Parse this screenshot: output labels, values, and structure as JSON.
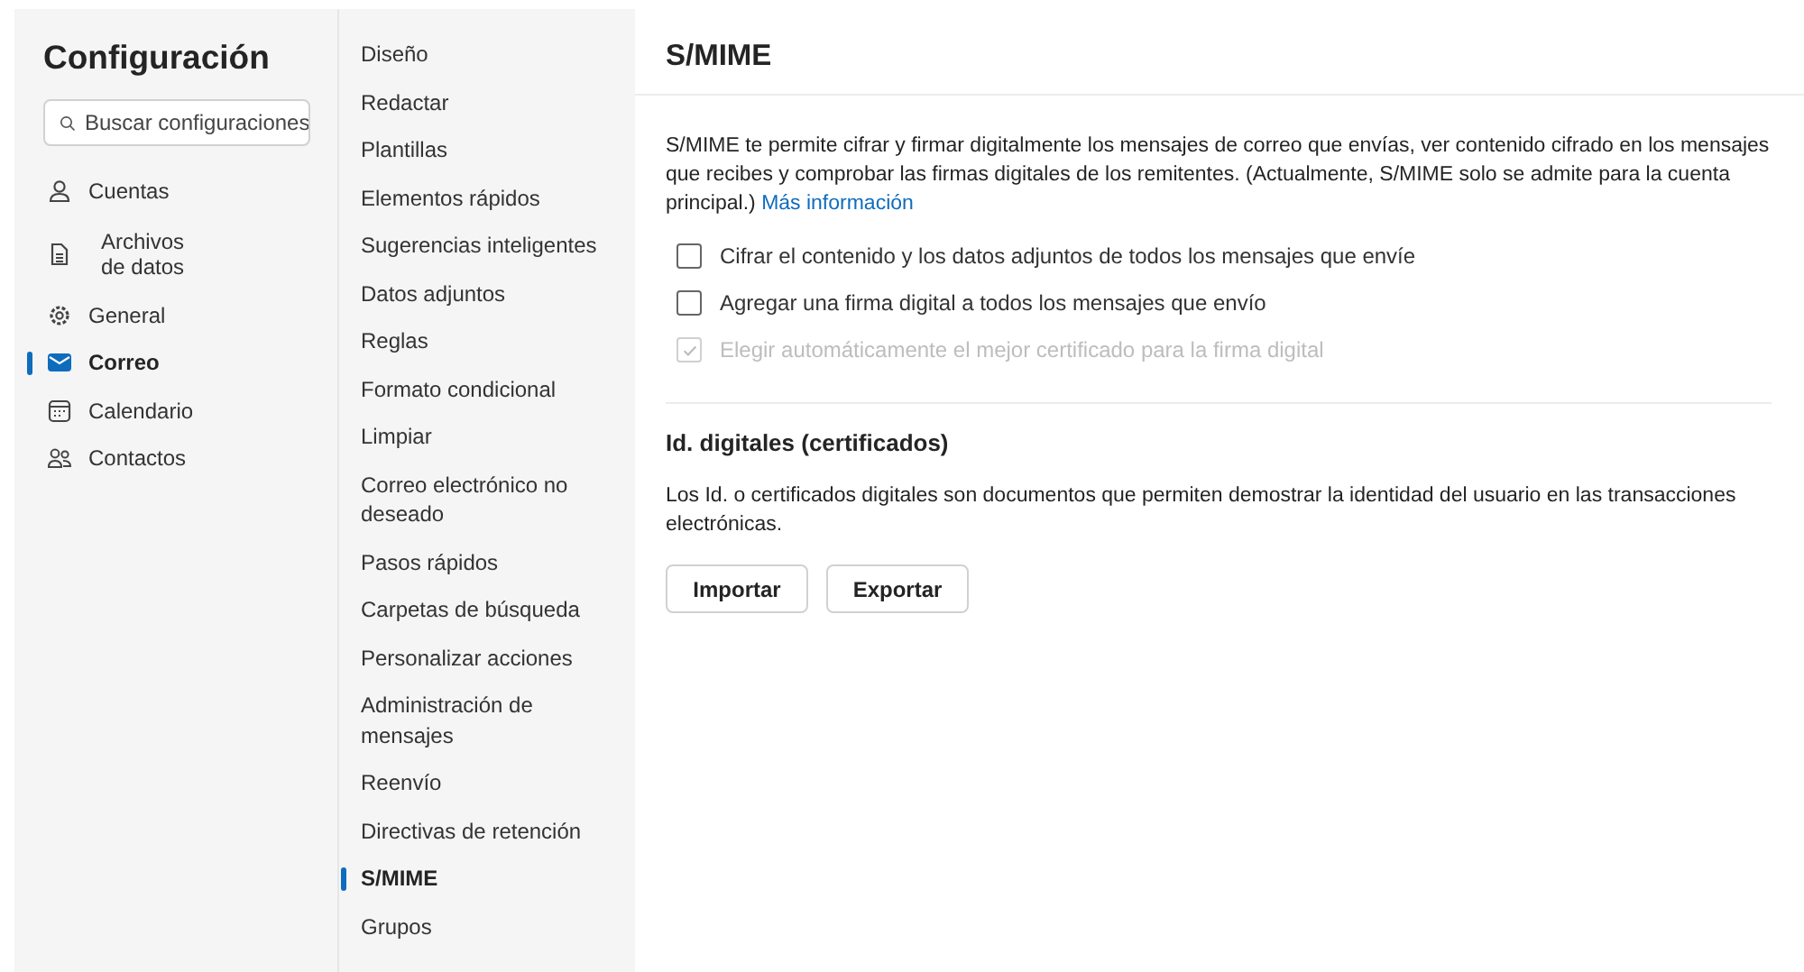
{
  "settings": {
    "title": "Configuración",
    "search": {
      "placeholder": "Buscar configuraciones"
    },
    "items": [
      {
        "label": "Cuentas",
        "selected": false
      },
      {
        "label": "Archivos de datos",
        "selected": false
      },
      {
        "label": "General",
        "selected": false
      },
      {
        "label": "Correo",
        "selected": true
      },
      {
        "label": "Calendario",
        "selected": false
      },
      {
        "label": "Contactos",
        "selected": false
      }
    ]
  },
  "submenu": [
    {
      "label": "Diseño",
      "selected": false
    },
    {
      "label": "Redactar",
      "selected": false
    },
    {
      "label": "Plantillas",
      "selected": false
    },
    {
      "label": "Elementos rápidos",
      "selected": false
    },
    {
      "label": "Sugerencias inteligentes",
      "selected": false
    },
    {
      "label": "Datos adjuntos",
      "selected": false
    },
    {
      "label": "Reglas",
      "selected": false
    },
    {
      "label": "Formato condicional",
      "selected": false
    },
    {
      "label": "Limpiar",
      "selected": false
    },
    {
      "label": "Correo electrónico no deseado",
      "selected": false
    },
    {
      "label": "Pasos rápidos",
      "selected": false
    },
    {
      "label": "Carpetas de búsqueda",
      "selected": false
    },
    {
      "label": "Personalizar acciones",
      "selected": false
    },
    {
      "label": "Administración de mensajes",
      "selected": false
    },
    {
      "label": "Reenvío",
      "selected": false
    },
    {
      "label": "Directivas de retención",
      "selected": false
    },
    {
      "label": "S/MIME",
      "selected": true
    },
    {
      "label": "Grupos",
      "selected": false
    }
  ],
  "content": {
    "title": "S/MIME",
    "description": "S/MIME te permite cifrar y firmar digitalmente los mensajes de correo que envías, ver contenido cifrado en los mensajes que recibes y comprobar las firmas digitales de los remitentes. (Actualmente, S/MIME solo se admite para la cuenta principal.)",
    "link": "Más información",
    "options": [
      {
        "label": "Cifrar el contenido y los datos adjuntos de todos los mensajes que envíe",
        "checked": false,
        "disabled": false
      },
      {
        "label": "Agregar una firma digital a todos los mensajes que envío",
        "checked": false,
        "disabled": false
      },
      {
        "label": "Elegir automáticamente el mejor certificado para la firma digital",
        "checked": true,
        "disabled": true
      }
    ],
    "section_title": "Id. digitales (certificados)",
    "section_text": "Los Id. o certificados digitales son documentos que permiten demostrar la identidad del usuario en las transacciones electrónicas.",
    "buttons": [
      "Importar",
      "Exportar"
    ]
  }
}
